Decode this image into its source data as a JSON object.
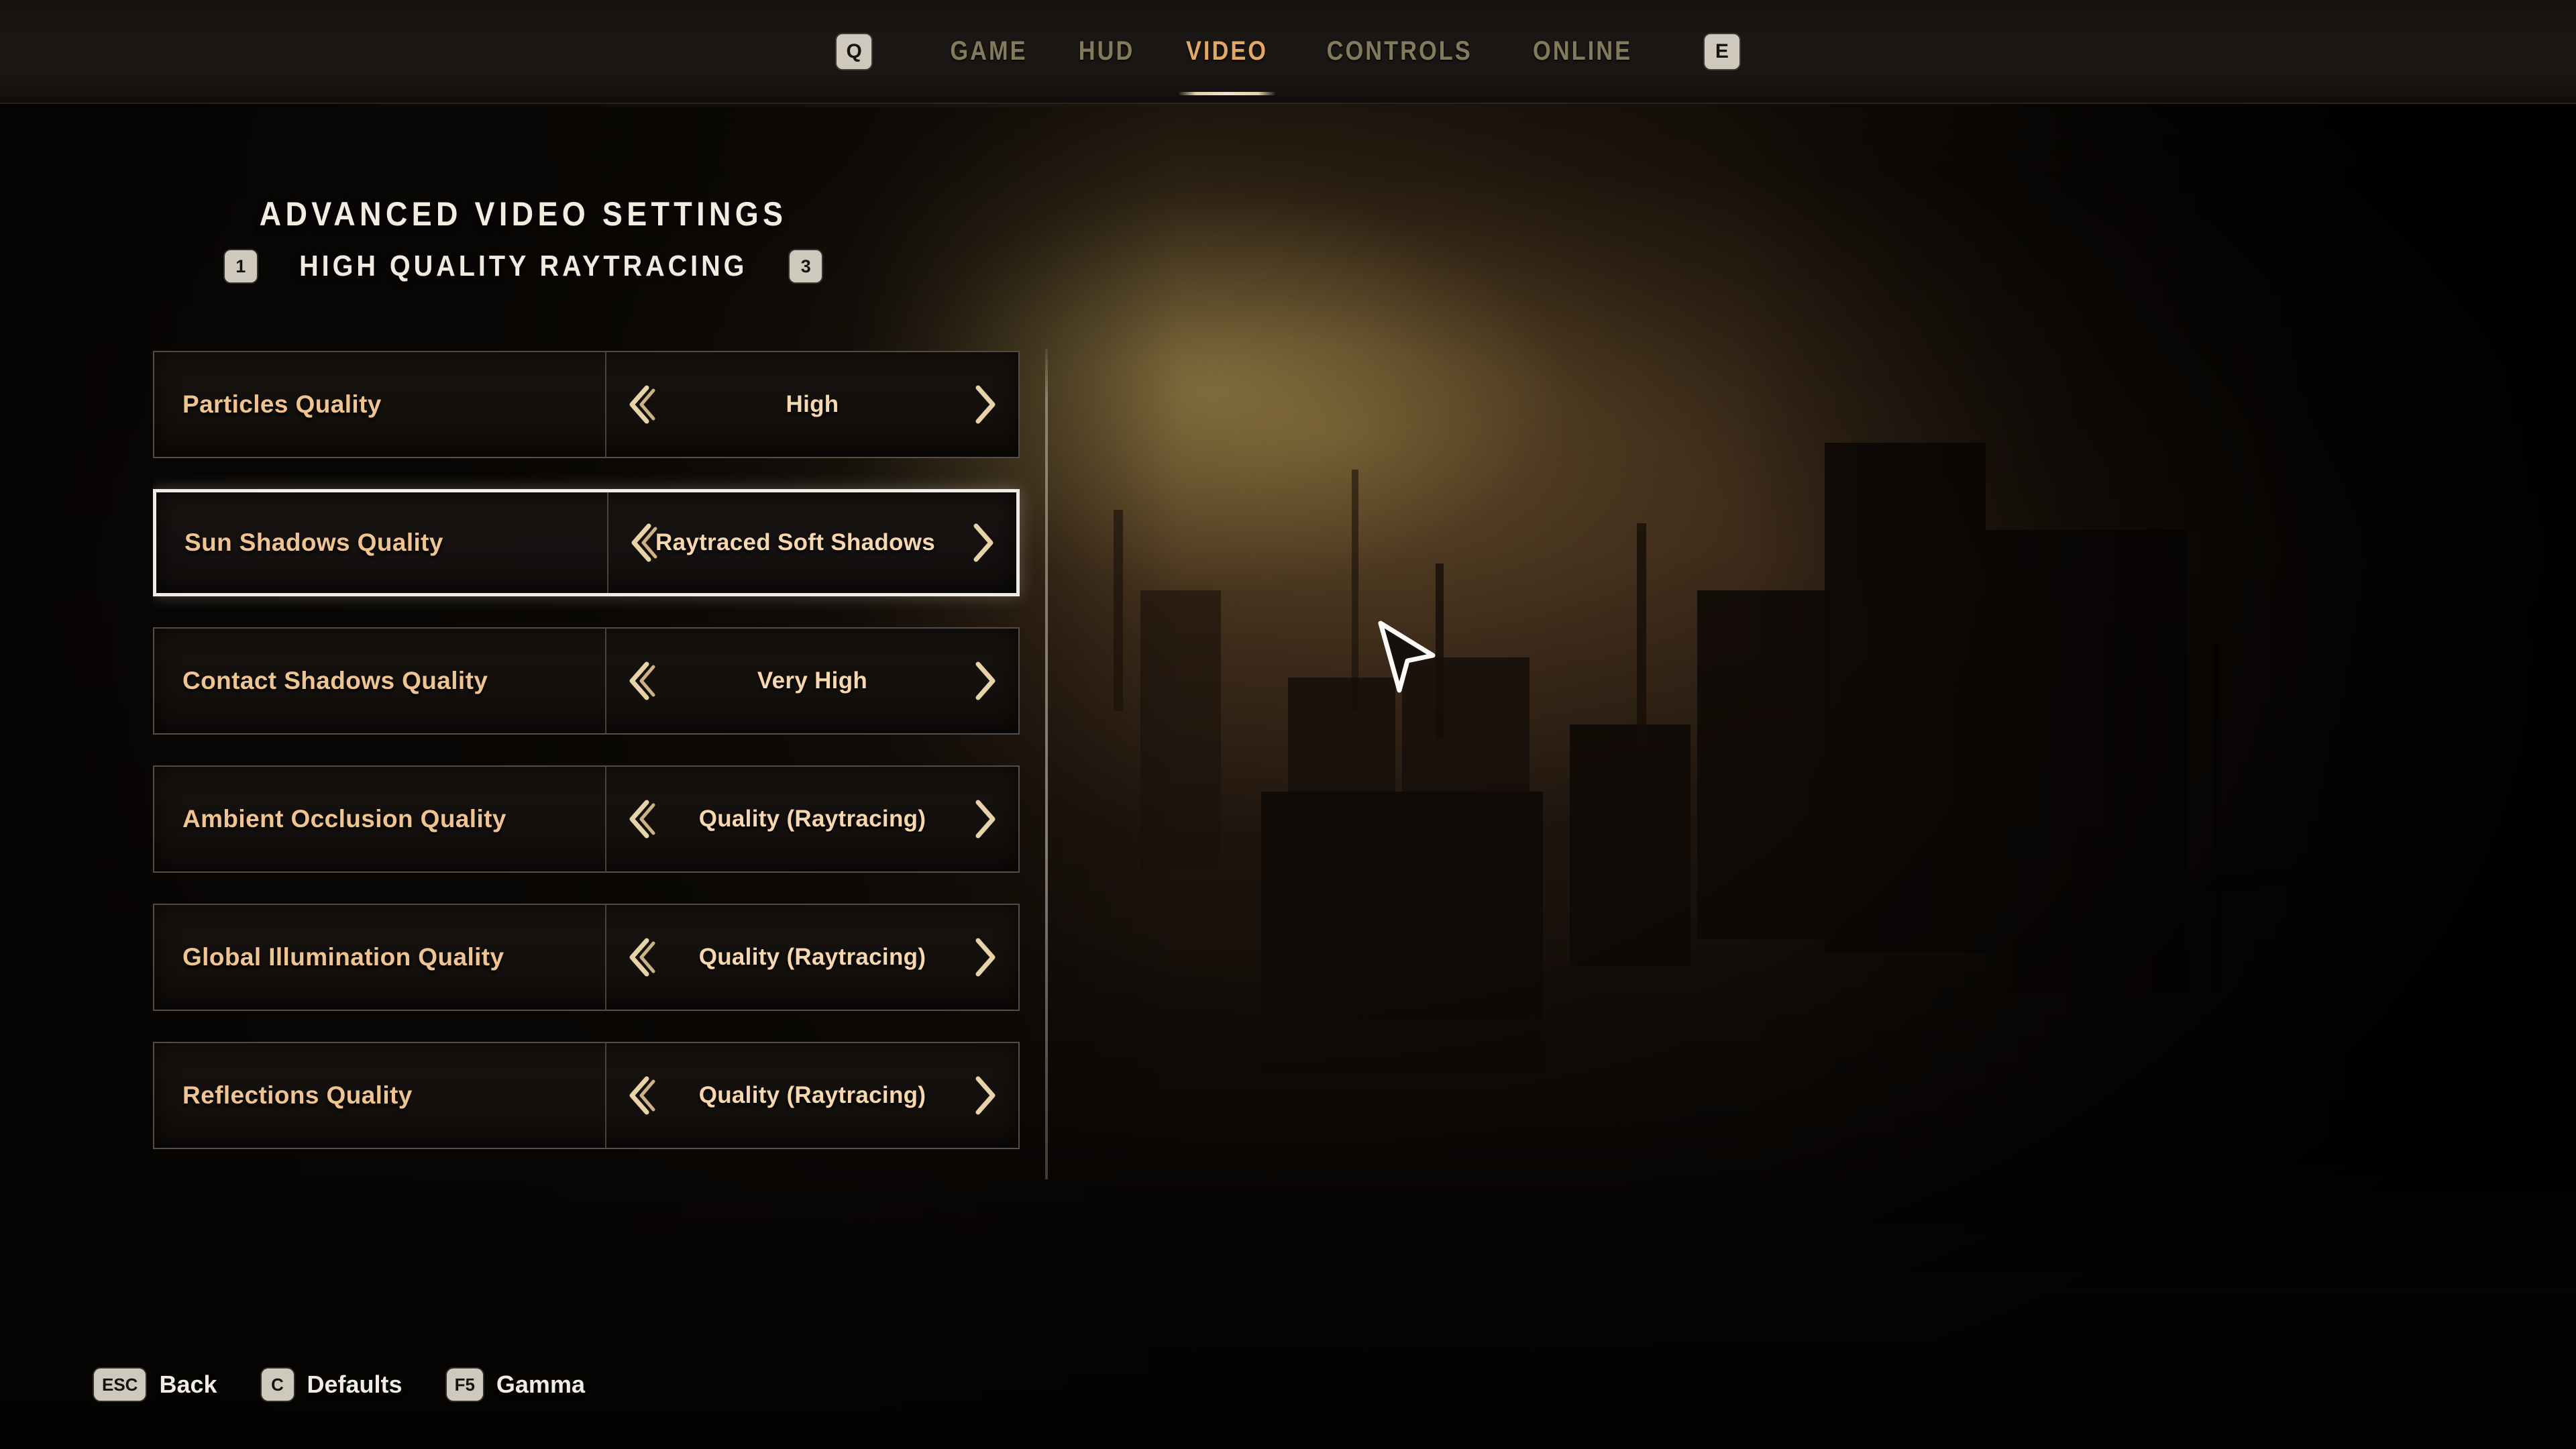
{
  "nav": {
    "left_key": "Q",
    "right_key": "E",
    "tabs": [
      {
        "label": "GAME",
        "active": false
      },
      {
        "label": "HUD",
        "active": false
      },
      {
        "label": "VIDEO",
        "active": true
      },
      {
        "label": "CONTROLS",
        "active": false
      },
      {
        "label": "ONLINE",
        "active": false
      }
    ]
  },
  "header": {
    "title": "ADVANCED VIDEO SETTINGS",
    "subtitle": "HIGH QUALITY RAYTRACING",
    "preset_prev_key": "1",
    "preset_next_key": "3"
  },
  "settings": {
    "rows": [
      {
        "label": "Particles Quality",
        "value": "High",
        "selected": false,
        "clipped": false
      },
      {
        "label": "Sun Shadows Quality",
        "value": "Raytraced Soft Shadows",
        "selected": true,
        "clipped": true
      },
      {
        "label": "Contact Shadows Quality",
        "value": "Very High",
        "selected": false,
        "clipped": false
      },
      {
        "label": "Ambient Occlusion Quality",
        "value": "Quality (Raytracing)",
        "selected": false,
        "clipped": false
      },
      {
        "label": "Global Illumination Quality",
        "value": "Quality (Raytracing)",
        "selected": false,
        "clipped": false
      },
      {
        "label": "Reflections Quality",
        "value": "Quality (Raytracing)",
        "selected": false,
        "clipped": false
      },
      {
        "label": "",
        "value": "",
        "selected": false,
        "clipped": false
      }
    ]
  },
  "footer": {
    "hints": [
      {
        "key": "ESC",
        "label": "Back"
      },
      {
        "key": "C",
        "label": "Defaults"
      },
      {
        "key": "F5",
        "label": "Gamma"
      }
    ]
  },
  "colors": {
    "accent_active_tab": "#e3a865",
    "tab_inactive": "#83795c",
    "row_label": "#f0c491",
    "row_value": "#f7d7ae",
    "selected_border": "#efece4",
    "key_badge_bg": "#cfc9bd"
  }
}
